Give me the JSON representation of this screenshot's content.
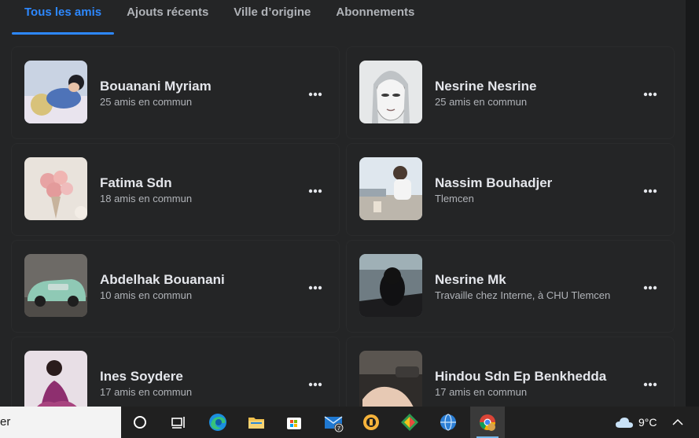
{
  "tabs": [
    {
      "label": "Tous les amis",
      "active": true
    },
    {
      "label": "Ajouts récents",
      "active": false
    },
    {
      "label": "Ville d’origine",
      "active": false
    },
    {
      "label": "Abonnements",
      "active": false
    }
  ],
  "friends": [
    {
      "name": "Bouanani Myriam",
      "subtitle": "25 amis en commun"
    },
    {
      "name": "Nesrine Nesrine",
      "subtitle": "25 amis en commun"
    },
    {
      "name": "Fatima Sdn",
      "subtitle": "18 amis en commun"
    },
    {
      "name": "Nassim Bouhadjer",
      "subtitle": "Tlemcen"
    },
    {
      "name": "Abdelhak Bouanani",
      "subtitle": "10 amis en commun"
    },
    {
      "name": "Nesrine Mk",
      "subtitle": "Travaille chez Interne, à CHU Tlemcen"
    },
    {
      "name": "Ines Soydere",
      "subtitle": "17 amis en commun"
    },
    {
      "name": "Hindou Sdn Ep Benkhedda",
      "subtitle": "17 amis en commun"
    }
  ],
  "taskbar": {
    "search_text": "er",
    "mail_badge": "7",
    "weather_temp": "9°C",
    "icons": [
      "cortana-icon",
      "task-view-icon",
      "edge-icon",
      "file-explorer-icon",
      "store-icon",
      "mail-icon",
      "app-icon",
      "app-icon",
      "browser-icon",
      "chrome-icon"
    ]
  },
  "colors": {
    "background": "#242526",
    "accent": "#2d88ff",
    "text_primary": "#e4e6eb",
    "text_secondary": "#b0b3b8",
    "taskbar": "#202020"
  }
}
